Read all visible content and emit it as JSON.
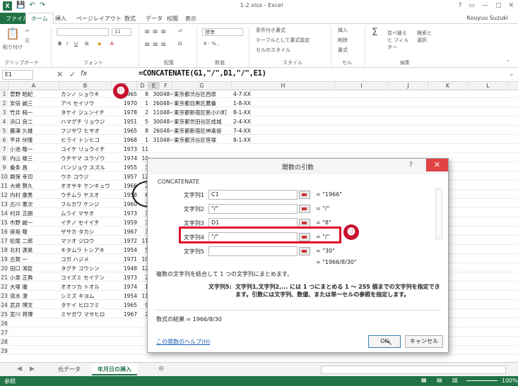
{
  "titlebar": {
    "title": "1-2.xlsx - Excel",
    "qat": [
      "💾",
      "↶",
      "↷"
    ],
    "win": [
      "?",
      "▭",
      "—",
      "▢",
      "✕"
    ]
  },
  "tabs": [
    "ファイル",
    "ホーム",
    "挿入",
    "ページレイアウト",
    "数式",
    "データ",
    "校閲",
    "表示"
  ],
  "user": "Kouyuu Suzuki",
  "ribbon": {
    "clip_paste": "貼り付け",
    "clip_group": "クリップボード",
    "font_size": "11",
    "font_group": "フォント",
    "align_group": "配置",
    "num_fmt": "標準",
    "num_group": "数値",
    "style1": "条件付き書式",
    "style2": "テーブルとして書式設定",
    "style3": "セルのスタイル",
    "style_group": "スタイル",
    "cell1": "挿入",
    "cell2": "削除",
    "cell3": "書式",
    "cell_group": "セル",
    "edit1": "並べ替えと フィルター",
    "edit2": "検索と 選択",
    "edit_group": "編集"
  },
  "namebox": "E1",
  "formula": "=CONCATENATE(G1,\"/\",D1,\"/\",E1)",
  "columns": [
    "A",
    "B",
    "C",
    "D",
    "E",
    "F",
    "G",
    "H",
    "I",
    "J",
    "K",
    "L"
  ],
  "rows": [
    [
      "1",
      "菅野 昭紀",
      "カンノ ショウキ",
      "1965",
      "8",
      "30",
      "048-0101-XXXX",
      "東京都渋谷区西原",
      "4-7-XX"
    ],
    [
      "2",
      "安倍 誠三",
      "アベ セイゾウ",
      "1970",
      "1",
      "26",
      "048-0141-XXXX",
      "東京都目黒区鷹番",
      "1-8-XX"
    ],
    [
      "3",
      "竹井 純一",
      "タケイ ジュンイチ",
      "1978",
      "2",
      "11",
      "048-0145-XXXX",
      "東京都新宿区新小川町",
      "8-1-XX"
    ],
    [
      "4",
      "浜口 良二",
      "ハマグチ リョウジ",
      "1951",
      "5",
      "30",
      "048-0115-XXXX",
      "東京都世田谷区成城",
      "2-4-XX"
    ],
    [
      "5",
      "藤澤 久雄",
      "フジサワ ヒサオ",
      "1965",
      "8",
      "26",
      "048-0116-XXXX",
      "東京都新宿区神楽坂",
      "7-4-XX"
    ],
    [
      "6",
      "平井 伏隆",
      "ヒライ トシヒコ",
      "1968",
      "1",
      "31",
      "048-0132-XXXX",
      "東京都渋谷区笹塚",
      "8-1-XX"
    ],
    [
      "7",
      "小池 隆一",
      "コイケ リュウイチ",
      "1973",
      "11",
      "",
      "",
      "",
      "",
      ""
    ],
    [
      "8",
      "内山 雄三",
      "ウチヤマ ユウゾウ",
      "1974",
      "10",
      "",
      "",
      "",
      "",
      ""
    ],
    [
      "9",
      "番条 昌",
      "バンジョウ スズル",
      "1955",
      "3",
      "",
      "",
      "",
      "",
      ""
    ],
    [
      "10",
      "鵜保 幸司",
      "ウホ コウジ",
      "1957",
      "12",
      "",
      "",
      "",
      "",
      ""
    ],
    [
      "11",
      "大崎 賢久",
      "オオサキ ケンキュウ",
      "1966",
      "2",
      "",
      "",
      "",
      "",
      ""
    ],
    [
      "12",
      "内村 康男",
      "ウチムラ ヤスオ",
      "1958",
      "6",
      "",
      "",
      "",
      "",
      ""
    ],
    [
      "13",
      "古川 憲次",
      "フルカワ ケンジ",
      "1960",
      "3",
      "",
      "",
      "",
      "",
      ""
    ],
    [
      "14",
      "村井 正朗",
      "ムライ マサオ",
      "1973",
      "3",
      "",
      "",
      "",
      "",
      ""
    ],
    [
      "15",
      "市野 誠一",
      "イチノ セイイチ",
      "1959",
      "3",
      "",
      "",
      "",
      "",
      ""
    ],
    [
      "16",
      "座坂 隆",
      "ザサカ タカシ",
      "1967",
      "3",
      "",
      "",
      "",
      "",
      ""
    ],
    [
      "17",
      "松尾 二郎",
      "マツオ ジロウ",
      "1972",
      "11",
      "",
      "",
      "",
      "",
      ""
    ],
    [
      "18",
      "北村 源昊",
      "キタムラ トシアキ",
      "1954",
      "5",
      "",
      "",
      "",
      "",
      ""
    ],
    [
      "19",
      "古賀 一",
      "コガ ハジメ",
      "1971",
      "10",
      "",
      "",
      "",
      "",
      ""
    ],
    [
      "20",
      "田口 鴻臣",
      "タグチ コウシン",
      "1948",
      "12",
      "",
      "",
      "",
      "",
      ""
    ],
    [
      "21",
      "小泉 正典",
      "コイズミ セイテン",
      "1973",
      "2",
      "",
      "",
      "",
      "",
      ""
    ],
    [
      "22",
      "大塚 徹",
      "オオツカ トオル",
      "1974",
      "1",
      "",
      "",
      "",
      "",
      ""
    ],
    [
      "23",
      "清水 澄",
      "シミズ キヨム",
      "1954",
      "11",
      "",
      "",
      "",
      "",
      ""
    ],
    [
      "24",
      "武井 博文",
      "タケイ ヒロフミ",
      "1965",
      "9",
      "",
      "",
      "",
      "",
      ""
    ],
    [
      "25",
      "宮川 将博",
      "ミヤガワ マサヒロ",
      "1967",
      "2",
      "",
      "",
      "",
      "",
      ""
    ],
    [
      "26",
      "",
      "",
      "",
      "",
      "",
      "",
      "",
      "",
      ""
    ],
    [
      "27",
      "",
      "",
      "",
      "",
      "",
      "",
      "",
      "",
      ""
    ],
    [
      "28",
      "",
      "",
      "",
      "",
      "",
      "",
      "",
      "",
      ""
    ],
    [
      "29",
      "",
      "",
      "",
      "",
      "",
      "",
      "",
      "",
      ""
    ]
  ],
  "sheets": [
    "元データ",
    "年月日の挿入"
  ],
  "status": {
    "mode": "参照",
    "zoom": "100%"
  },
  "dialog": {
    "title": "関数の引数",
    "function": "CONCATENATE",
    "args": [
      {
        "label": "文字列1",
        "input": "C1",
        "value": "= \"1966\""
      },
      {
        "label": "文字列2",
        "input": "\"/\"",
        "value": "= \"/\""
      },
      {
        "label": "文字列3",
        "input": "D1",
        "value": "= \"8\""
      },
      {
        "label": "文字列4",
        "input": "\"/\"",
        "value": "= \"/\""
      },
      {
        "label": "文字列5",
        "input": "",
        "value": "= \"30\""
      }
    ],
    "result_preview": "= \"1966/8/30\"",
    "description": "複数の文字列を結合して 1 つの文字列にまとめます。",
    "arg_help_label": "文字列5:",
    "arg_help": "文字列1,文字列2,... には 1 つにまとめる 1 ～ 255 個までの文字列を指定できます。引数には文字列、数値、または単一セルの参照を指定します。",
    "formula_result": "数式の結果 = 1966/8/30",
    "help_link": "この関数のヘルプ(H)",
    "ok": "OK",
    "cancel": "キャンセル"
  },
  "callouts": [
    "⓫",
    "⓬"
  ]
}
